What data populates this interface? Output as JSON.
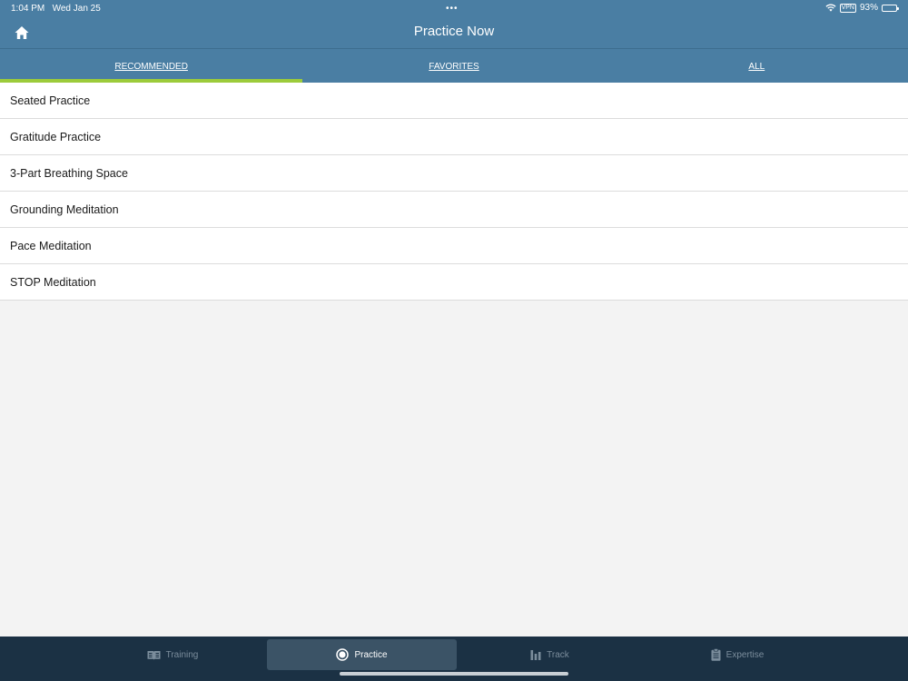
{
  "status_bar": {
    "time": "1:04 PM",
    "date": "Wed Jan 25",
    "dots": "•••",
    "vpn": "VPN",
    "battery": "93%",
    "battery_level": 0.93
  },
  "header": {
    "title": "Practice Now",
    "home_icon": "home-icon"
  },
  "tabs": [
    {
      "label": "RECOMMENDED",
      "active": true
    },
    {
      "label": "FAVORITES",
      "active": false
    },
    {
      "label": "ALL",
      "active": false
    }
  ],
  "practices": [
    "Seated Practice",
    "Gratitude Practice",
    "3-Part Breathing Space",
    "Grounding Meditation",
    "Pace Meditation",
    "STOP Meditation"
  ],
  "tabbar": [
    {
      "label": "Training",
      "icon": "book-icon",
      "active": false
    },
    {
      "label": "Practice",
      "icon": "practice-circle-icon",
      "active": true
    },
    {
      "label": "Track",
      "icon": "bar-chart-icon",
      "active": false
    },
    {
      "label": "Expertise",
      "icon": "clipboard-icon",
      "active": false
    }
  ],
  "colors": {
    "header": "#4a7ea3",
    "active_tab_indicator": "#9ccb3b",
    "tabbar": "#1b3144"
  }
}
